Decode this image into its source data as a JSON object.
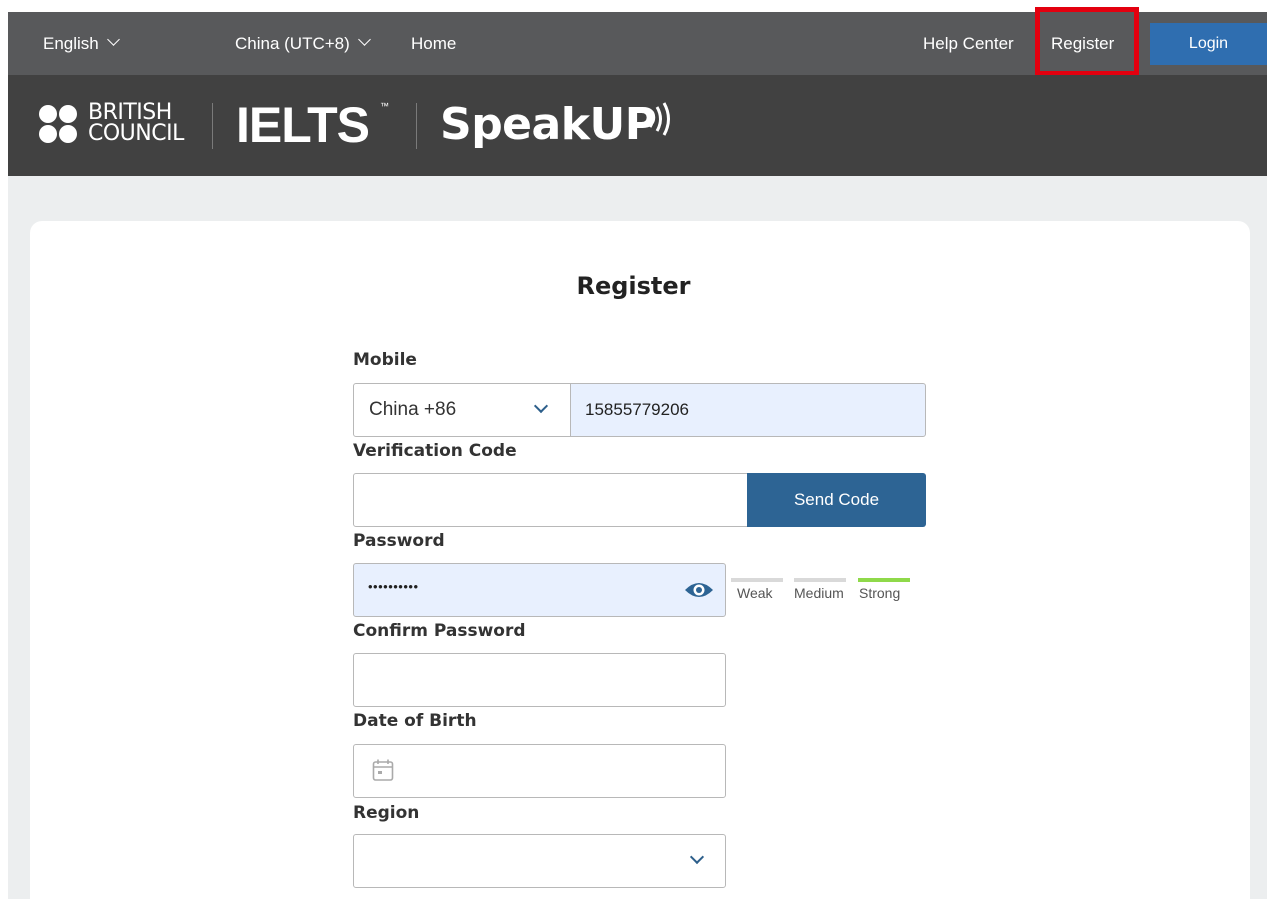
{
  "topbar": {
    "language": "English",
    "timezone": "China (UTC+8)",
    "home": "Home",
    "help_center": "Help Center",
    "register": "Register",
    "login": "Login"
  },
  "brand": {
    "british_council_line1": "BRITISH",
    "british_council_line2": "COUNCIL",
    "ielts": "IELTS",
    "ielts_tm": "™",
    "speakup": "SpeakUP"
  },
  "form": {
    "title": "Register",
    "mobile_label": "Mobile",
    "country_code": "China +86",
    "mobile_value": "15855779206",
    "verification_label": "Verification Code",
    "verification_value": "",
    "send_code": "Send Code",
    "password_label": "Password",
    "password_masked": "••••••••••",
    "strength_levels": [
      "Weak",
      "Medium",
      "Strong"
    ],
    "strength_active": "Strong",
    "confirm_password_label": "Confirm Password",
    "dob_label": "Date of Birth",
    "region_label": "Region"
  },
  "colors": {
    "topbar_bg": "#58595b",
    "brandbar_bg": "#414141",
    "login_button": "#2f6eb0",
    "send_code_button": "#2d6494",
    "highlight": "#e3000f",
    "strength_strong": "#8fd94a",
    "strength_inactive": "#d9d9d9",
    "autofill_bg": "#e8f0fe"
  }
}
